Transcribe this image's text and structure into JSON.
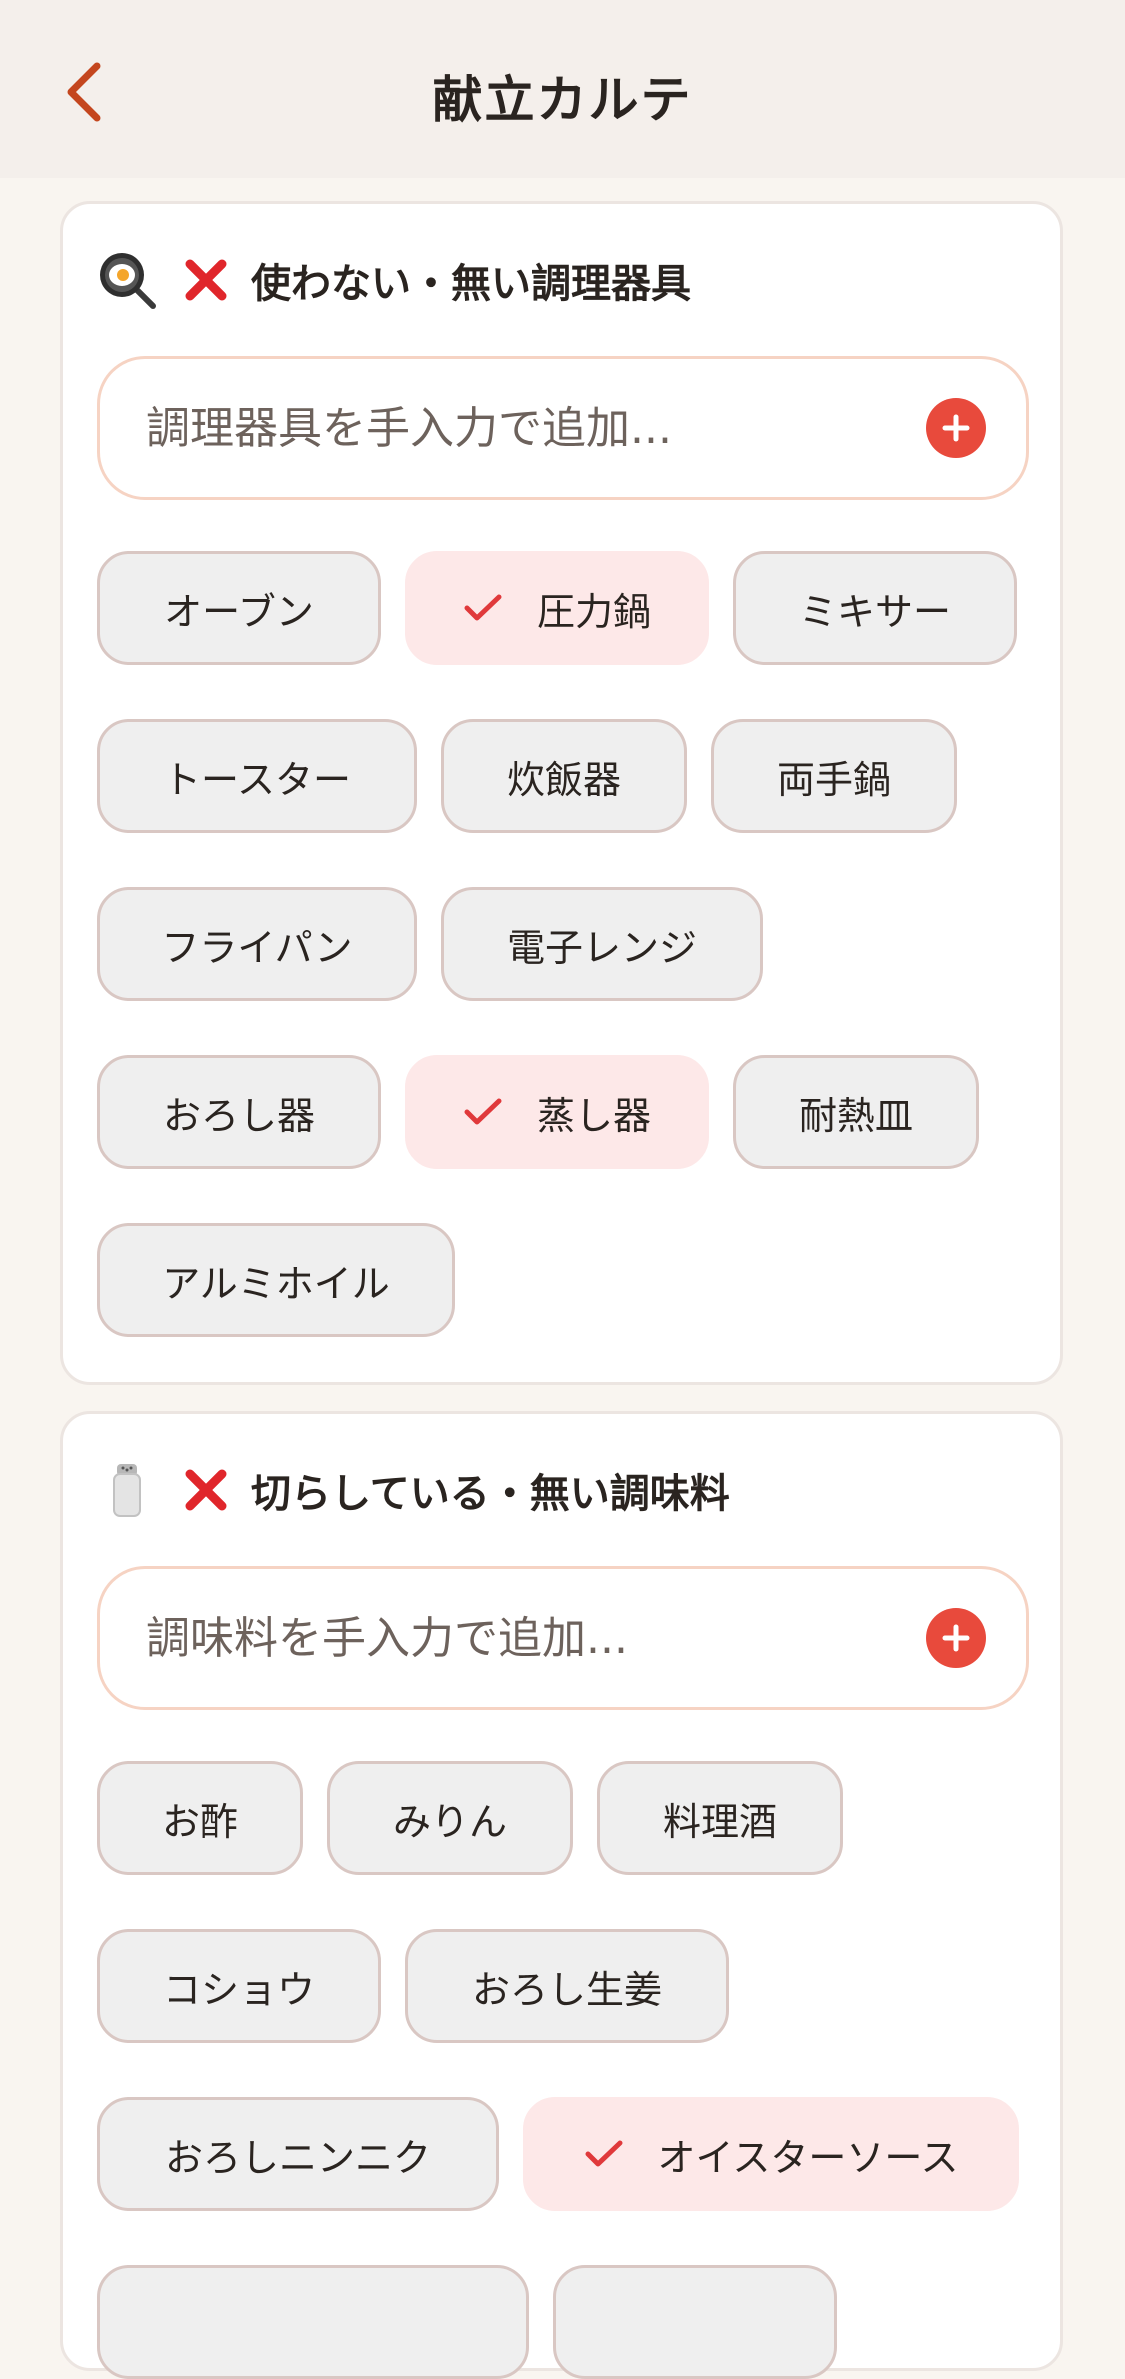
{
  "header": {
    "title": "献立カルテ"
  },
  "accent": "#e84a3c",
  "sections": [
    {
      "title": "使わない・無い調理器具",
      "icon": "frying-pan-egg-icon",
      "input_placeholder": "調理器具を手入力で追加...",
      "chips": [
        {
          "label": "オーブン",
          "selected": false
        },
        {
          "label": "圧力鍋",
          "selected": true
        },
        {
          "label": "ミキサー",
          "selected": false
        },
        {
          "label": "トースター",
          "selected": false
        },
        {
          "label": "炊飯器",
          "selected": false
        },
        {
          "label": "両手鍋",
          "selected": false
        },
        {
          "label": "フライパン",
          "selected": false
        },
        {
          "label": "電子レンジ",
          "selected": false
        },
        {
          "label": "おろし器",
          "selected": false
        },
        {
          "label": "蒸し器",
          "selected": true
        },
        {
          "label": "耐熱皿",
          "selected": false
        },
        {
          "label": "アルミホイル",
          "selected": false
        }
      ]
    },
    {
      "title": "切らしている・無い調味料",
      "icon": "salt-shaker-icon",
      "input_placeholder": "調味料を手入力で追加...",
      "chips": [
        {
          "label": "お酢",
          "selected": false
        },
        {
          "label": "みりん",
          "selected": false
        },
        {
          "label": "料理酒",
          "selected": false
        },
        {
          "label": "コショウ",
          "selected": false
        },
        {
          "label": "おろし生姜",
          "selected": false
        },
        {
          "label": "おろしニンニク",
          "selected": false
        },
        {
          "label": "オイスターソース",
          "selected": true
        }
      ]
    }
  ]
}
